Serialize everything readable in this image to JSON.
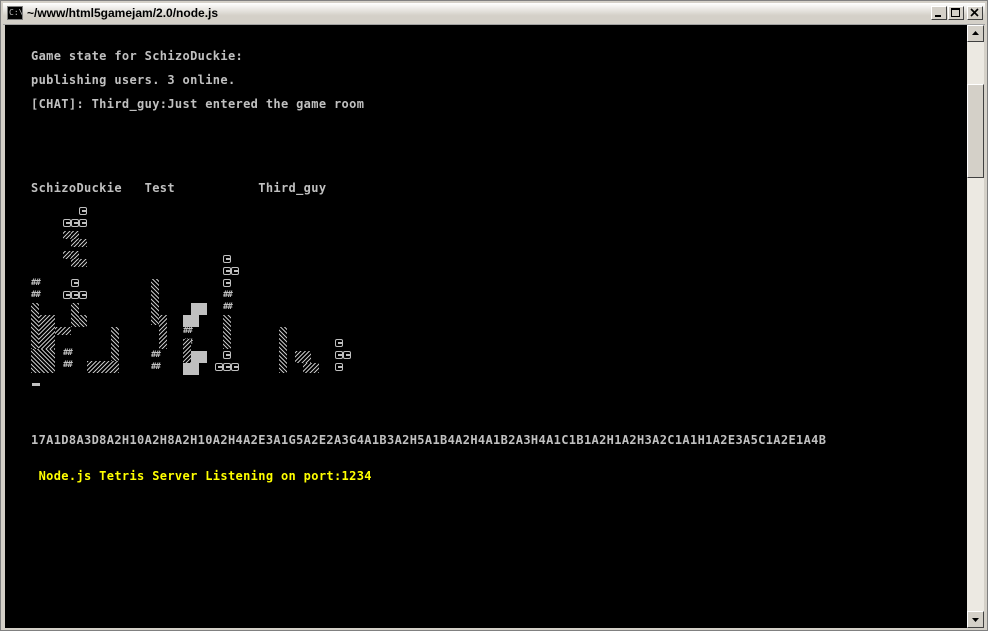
{
  "window": {
    "title": "~/www/html5gamejam/2.0/node.js",
    "icon_label": "C:\\"
  },
  "console": {
    "lines": [
      "Game state for SchizoDuckie:",
      "publishing users. 3 online.",
      "[CHAT]: Third_guy:Just entered the game room",
      "SchizoDuckie   Test           Third_guy",
      "17A1D8A3D8A2H10A2H8A2H10A2H4A2E3A1G5A2E2A3G4A1B3A2H5A1B4A2H4A1B2A3H4A1C1B1A2H1A2H3A2C1A1H1A2E3A5C1A2E1A4B",
      " Node.js Tetris Server Listening on port:1234"
    ]
  },
  "colors": {
    "console_bg": "#000000",
    "console_text": "#c0c0c0",
    "highlight_text": "#ffff00"
  },
  "icons": [
    "console-app-icon",
    "minimize-icon",
    "maximize-icon",
    "close-icon",
    "scroll-up-icon",
    "scroll-down-icon"
  ]
}
